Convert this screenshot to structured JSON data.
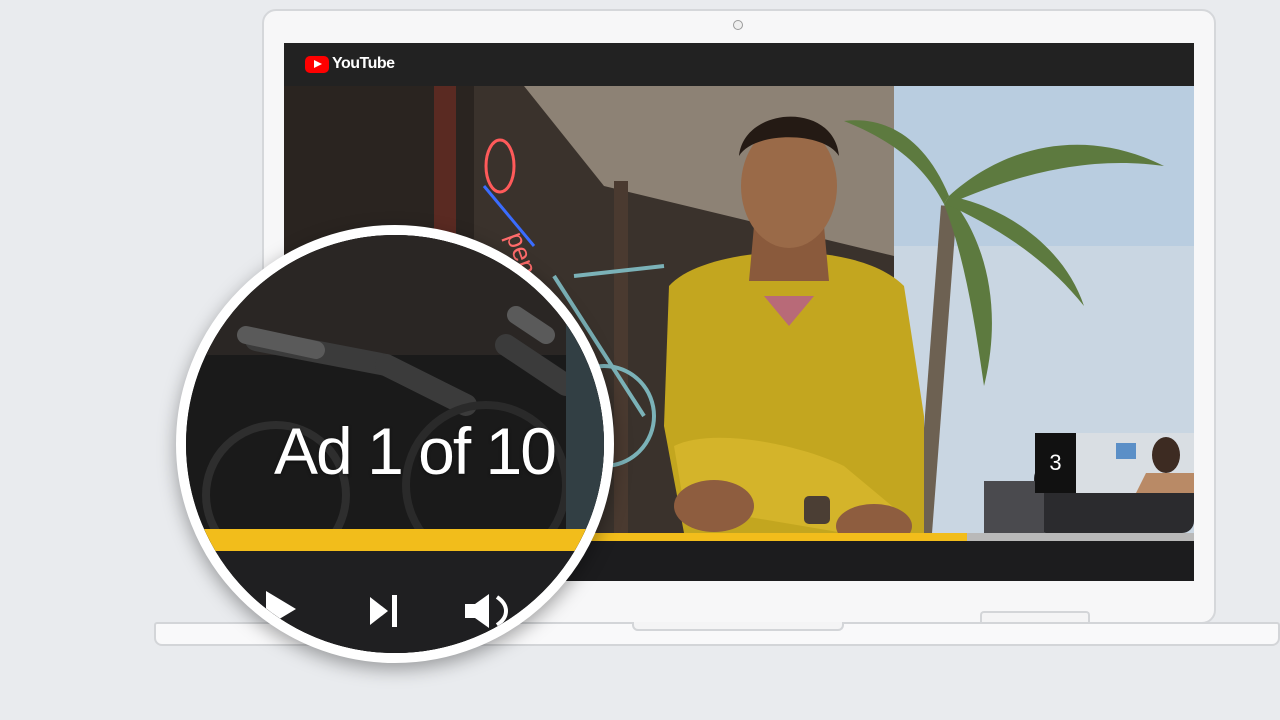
{
  "screen": {
    "brand": {
      "name": "YouTube",
      "icon": "youtube-play-icon"
    },
    "video": {
      "description_neon_sign": "Open",
      "progress_fraction": 0.75
    },
    "up_next_thumb": {
      "count": "3"
    }
  },
  "magnifier": {
    "ad_label": "Ad 1 of 10",
    "controls": [
      {
        "name": "play-icon"
      },
      {
        "name": "skip-next-icon"
      },
      {
        "name": "volume-icon"
      }
    ]
  },
  "colors": {
    "accent_yellow": "#f2bd1b",
    "youtube_red": "#ff0000",
    "bar_dark": "#222222"
  }
}
